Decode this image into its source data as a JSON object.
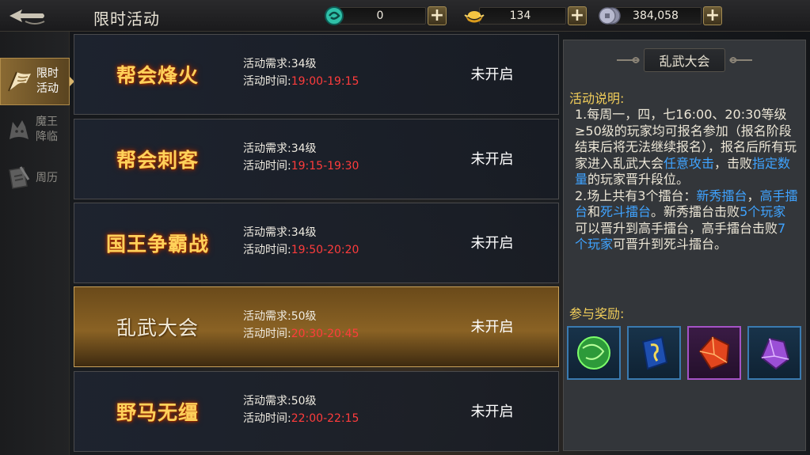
{
  "header": {
    "title": "限时活动",
    "currencies": [
      {
        "icon": "jade-icon",
        "value": "0"
      },
      {
        "icon": "gold-ingot-icon",
        "value": "134"
      },
      {
        "icon": "silver-coin-icon",
        "value": "384,058"
      }
    ],
    "plus_label": "+"
  },
  "sidebar": {
    "items": [
      {
        "label": "限时活动",
        "icon": "banner-icon",
        "active": true
      },
      {
        "label": "魔王降临",
        "icon": "wolf-icon",
        "active": false
      },
      {
        "label": "周历",
        "icon": "calendar-icon",
        "active": false
      }
    ]
  },
  "events": [
    {
      "name": "帮会烽火",
      "req": "活动需求:34级",
      "time_label": "活动时间:",
      "time": "19:00-19:15",
      "status": "未开启"
    },
    {
      "name": "帮会刺客",
      "req": "活动需求:34级",
      "time_label": "活动时间:",
      "time": "19:15-19:30",
      "status": "未开启"
    },
    {
      "name": "国王争霸战",
      "req": "活动需求:34级",
      "time_label": "活动时间:",
      "time": "19:50-20:20",
      "status": "未开启"
    },
    {
      "name": "乱武大会",
      "req": "活动需求:50级",
      "time_label": "活动时间:",
      "time": "20:30-20:45",
      "status": "未开启"
    },
    {
      "name": "野马无缰",
      "req": "活动需求:50级",
      "time_label": "活动时间:",
      "time": "22:00-22:15",
      "status": "未开启"
    }
  ],
  "selected_event": 3,
  "detail": {
    "title": "乱武大会",
    "desc_label": "活动说明:",
    "p1": [
      "1.每周一，四，七16:00、20:30等级≥50级的玩家均可报名参加（报名阶段结束后将无法继续报名），报名后所有玩家进入乱武大会",
      "任意攻击",
      "，击败",
      "指定数量",
      "的玩家晋升段位。"
    ],
    "p2": [
      "2.场上共有3个擂台：",
      "新秀擂台",
      "，",
      "高手擂台",
      "和",
      "死斗擂台",
      "。新秀擂台击败",
      "5个玩家",
      "可以晋升到高手擂台，高手擂台击败",
      "7个玩家",
      "可晋升到死斗擂台。"
    ],
    "rewards_label": "参与奖励:",
    "rewards": [
      {
        "icon": "green-orb-icon",
        "frame": "blue"
      },
      {
        "icon": "rune-stone-icon",
        "frame": "blue"
      },
      {
        "icon": "red-crystal-icon",
        "frame": "purple"
      },
      {
        "icon": "purple-crystal-icon",
        "frame": "blue"
      }
    ]
  },
  "colors": {
    "accent_gold": "#ffd15a",
    "time_red": "#ff3c3c",
    "link_blue": "#3fa3ff",
    "section_yellow": "#f2ce5a"
  }
}
